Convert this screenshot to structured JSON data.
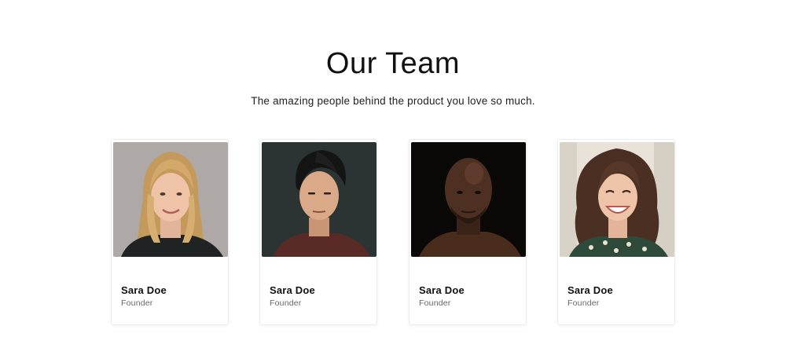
{
  "section": {
    "title": "Our Team",
    "subtitle": "The amazing people behind the product you love so much."
  },
  "members": [
    {
      "name": "Sara Doe",
      "role": "Founder",
      "photo": "portrait-blonde-woman"
    },
    {
      "name": "Sara Doe",
      "role": "Founder",
      "photo": "portrait-dark-haired-man"
    },
    {
      "name": "Sara Doe",
      "role": "Founder",
      "photo": "portrait-bald-man"
    },
    {
      "name": "Sara Doe",
      "role": "Founder",
      "photo": "portrait-curly-haired-woman"
    }
  ]
}
